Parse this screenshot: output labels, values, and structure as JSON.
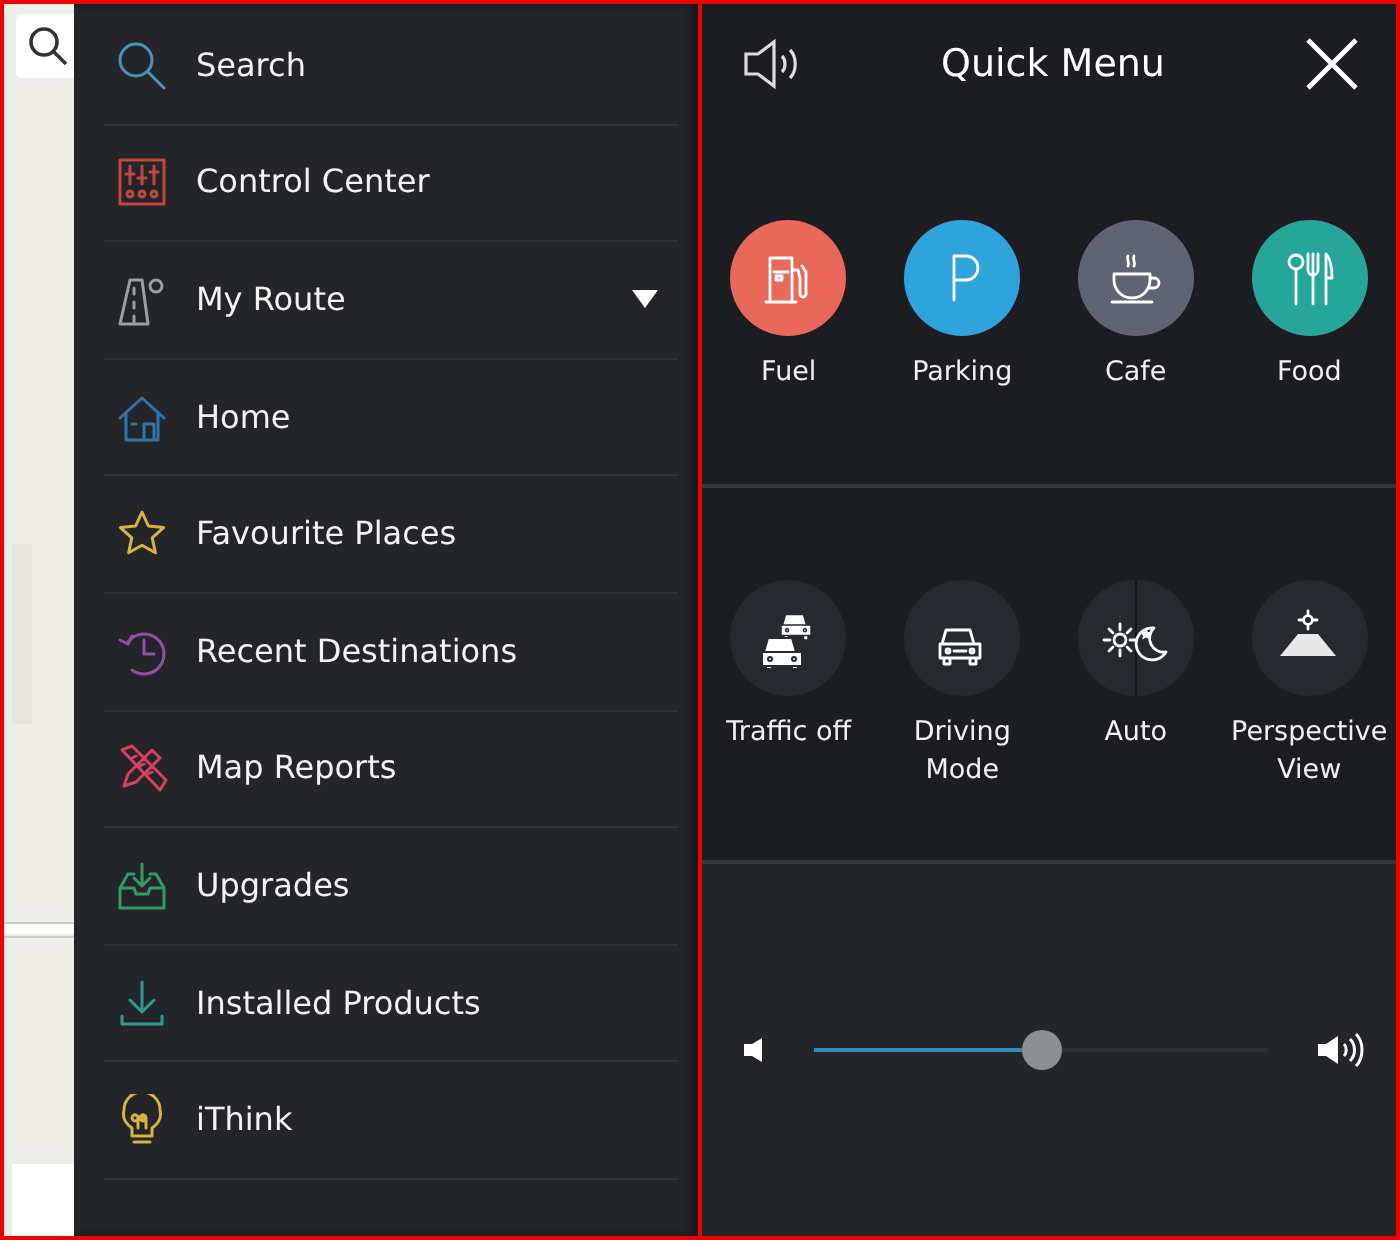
{
  "menu": {
    "items": [
      {
        "label": "Search",
        "expandable": false
      },
      {
        "label": "Control Center",
        "expandable": false
      },
      {
        "label": "My Route",
        "expandable": true
      },
      {
        "label": "Home",
        "expandable": false
      },
      {
        "label": "Favourite Places",
        "expandable": false
      },
      {
        "label": "Recent Destinations",
        "expandable": false
      },
      {
        "label": "Map Reports",
        "expandable": false
      },
      {
        "label": "Upgrades",
        "expandable": false
      },
      {
        "label": "Installed Products",
        "expandable": false
      },
      {
        "label": "iThink",
        "expandable": false
      }
    ]
  },
  "quick_menu": {
    "title": "Quick Menu",
    "places": [
      {
        "label": "Fuel",
        "color": "#e8695a"
      },
      {
        "label": "Parking",
        "color": "#2ea3dc"
      },
      {
        "label": "Cafe",
        "color": "#5d6473"
      },
      {
        "label": "Food",
        "color": "#26a69a"
      }
    ],
    "settings": [
      {
        "label": "Traffic off"
      },
      {
        "label": "Driving Mode"
      },
      {
        "label": "Auto"
      },
      {
        "label": "Perspective View"
      }
    ],
    "volume": {
      "level": 0.5
    }
  }
}
